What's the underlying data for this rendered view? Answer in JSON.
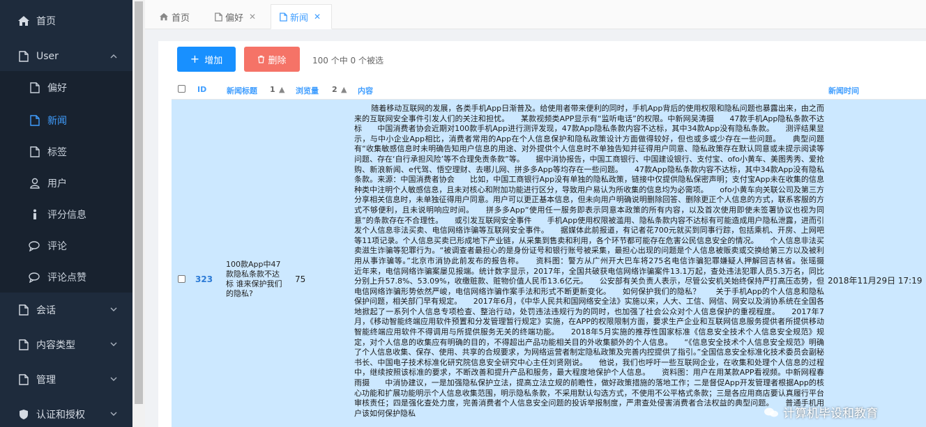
{
  "sidebar": {
    "items": [
      {
        "label": "首页",
        "icon": "home-icon"
      },
      {
        "label": "User",
        "icon": "document-icon",
        "expanded": true
      }
    ],
    "user_sub": [
      {
        "label": "偏好",
        "icon": "document-icon"
      },
      {
        "label": "新闻",
        "icon": "document-icon",
        "active": true
      },
      {
        "label": "标签",
        "icon": "document-icon"
      },
      {
        "label": "用户",
        "icon": "user-icon"
      },
      {
        "label": "评分信息",
        "icon": "info-icon"
      },
      {
        "label": "评论",
        "icon": "comment-icon"
      },
      {
        "label": "评论点赞",
        "icon": "comment-icon"
      }
    ],
    "groups": [
      {
        "label": "会话",
        "icon": "document-icon"
      },
      {
        "label": "内容类型",
        "icon": "document-icon"
      },
      {
        "label": "管理",
        "icon": "document-icon"
      },
      {
        "label": "认证和授权",
        "icon": "shield-icon"
      }
    ]
  },
  "tabs": [
    {
      "label": "首页",
      "icon": "home-icon"
    },
    {
      "label": "偏好",
      "icon": "document-icon",
      "closable": true
    },
    {
      "label": "新闻",
      "icon": "document-icon",
      "closable": true,
      "active": true
    }
  ],
  "toolbar": {
    "add_label": "增加",
    "delete_label": "删除",
    "selection_count": "100 个中 0 个被选"
  },
  "table": {
    "columns": {
      "id": "ID",
      "title": "新闻标题",
      "title_sort": "1",
      "views": "浏览量",
      "views_sort": "2",
      "content": "内容",
      "time": "新闻时间"
    },
    "row": {
      "id": "323",
      "title": "100款App中47款隐私条款不达标 谁来保护我们的隐私?",
      "views": "75",
      "content": "随着移动互联网的发展，各类手机App日渐普及。给使用者带来便利的同时，手机App背后的使用权限和隐私问题也暴露出来，由之而来的互联网安全事件引发人们的关注和担忧。　　某款视频类APP显示有“监听电话”的权限。中新网吴涛摄　　47款手机App隐私条款不达标　　中国消费者协会近期对100款手机App进行测评发现，47款App隐私条款内容不达标，其中34款App没有隐私条款。　　测评结果显示，与中小企业App相比，消费者常用的App在个人信息保护和隐私政策设计方面做得较好，但也或多或少存在一些问题。　　典型问题有“收集敏感信息时未明确告知用户信息的用途、对外提供个人信息时不单独告知并征得用户同意、隐私政策存在默认同意或未提示阅读等问题、存在‘自行承担风险’等不合理免责条款”等。　　据中消协报告，中国工商银行、中国建设银行、支付宝、ofo小黄车、美图秀秀、爱抢购、新浪新闻、e代驾、悟空理财、去哪儿网、拼多多App等均存在一些问题。　　47款App隐私条款内容不达标，其中34款App没有隐私条款。来源：中国消费者协会　　比如，中国工商银行App没有单独的隐私政策，链接中仅提供隐私保密声明；支付宝App未在收集的信息种类中注明个人敏感信息，且未对核心和附加功能进行区分，导致用户易认为所收集的信息均为必需项。　　ofo小黄车向关联公司及第三方分享相关信息时，未单独征得用户同意。用户可以更正基本信息，但未向用户明确说明删除回答、删除更正个人信息的方式，联系客服的方式不够便利，且未说明响应时间。　　拼多多App“使用任一服务即表示同意本政策的所有内容，以及首次使用即使未签署协议也视为同意”的条款存在不合理性。　　或引发互联网安全事件　　手机App使用权限被滥用、隐私条款内容不达标有可能造成用户隐私泄露，进而引发个人信息非法买卖、电信网络诈骗等互联网安全事件。　　据媒体此前报道，有记者花700元就买到同事行踪，包括乘机、开房、上网吧等11项记录。个人信息买卖已形成地下产业链，从采集到售卖和利用，各个环节都可能存在危害公民信息安全的情况。　　个人信息非法买卖滋生诈骗等犯罪行为。“被调查者最担心的是身份证号和银行账号被采集，最担心出现的问题是个人信息被贩卖或交换给第三方以及被利用从事诈骗等。”北京市消协此前发布的报告称。　　资料图：警方从广州开大巴车将275名电信诈骗犯罪嫌疑人押解回吉林省。张瑶摄　　近年来，电信网络诈骗案屡见报端。统计数字显示，2017年，全国共破获电信网络诈骗案件13.1万起，查处违法犯罪人员5.3万名，同比分别上升57.8%、53.09%，收缴赃款、赃物价值人民币13.6亿元。　　公安部有关负责人表示，尽管公安机关始终保持严打高压态势，但电信网络诈骗形势依然严峻，电信网络诈骗作案手法和形式不断更新变化。　　如何保护我们的隐私？　　关于手机App的个人信息和隐私保护问题，相关部门早有规定。　　2017年6月，《中华人民共和国网络安全法》实施以来，人大、工信、网信、网安以及消协系统在全国各地掀起了一系列个人信息专项检查、整治行动，处罚违法违规行为的同时，也加强了社会公众对个人信息保护的重视程度。　　2017年7月，《移动智能终端应用软件预置和分发管理暂行规定》实施，在APP的权限限制方面，要求生产企业和互联网信息服务提供者所提供移动智能终端应用软件不得调用与所提供服务无关的终端功能。　　2018年5月实施的推荐性国家标准《信息安全技术个人信息安全规范》规定，对个人信息的收集应有明确的目的，不得超出产品功能相关目的外收集额外的个人信息。　　“《信息安全技术个人信息安全规范》明确了个人信息收集、保存、使用、共享的合规要求，为网络运营者制定隐私政策及完善内控提供了指引。”全国信息安全标准化技术委员会副秘书长、中国电子技术标准化研究院信息安全研究中心主任刘贤刚说。　　他说，我们也呼吁一些互联网企业，在收集和处理个人信息的过程中，继续按照该标准的要求，不断改善和提升产品和服务，最大程度地保护个人信息。　　资料图：用户在用某款APP看视频。中新网程春雨摄　　中消协建议，一是加强隐私保护立法，提高立法立规的前瞻性，做好政策措施的落地工作；二是督促App开发管理者根据App的核心功能和扩展功能明示个人信息收集范围，明示隐私条款，不采用默认勾选方式，不使用不公平格式条款；三是各应用商店要认真履行平台审核责任；四是强化查处力度，完善消费者个人信息安全问题的投诉举报制度，严肃查处侵害消费者合法权益的典型问题。　　普通手机用户该如何保护隐私",
      "time": "2018年11月29日 17:19"
    }
  },
  "watermark": {
    "text": "计算机毕设和教育"
  },
  "colors": {
    "sidebar_bg": "#1e2b3c",
    "accent": "#409eff",
    "add_button": "#1890ff",
    "delete_button": "#f57367",
    "selected_row": "#cce8ff"
  }
}
